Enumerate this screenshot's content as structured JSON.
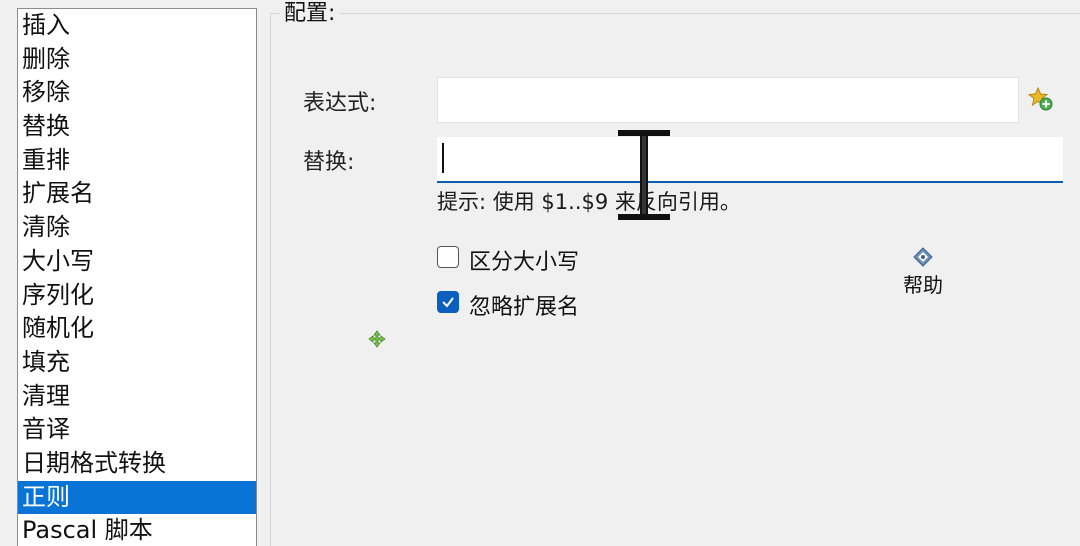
{
  "rules_list": {
    "items": [
      {
        "label": "插入",
        "selected": false
      },
      {
        "label": "删除",
        "selected": false
      },
      {
        "label": "移除",
        "selected": false
      },
      {
        "label": "替换",
        "selected": false
      },
      {
        "label": "重排",
        "selected": false
      },
      {
        "label": "扩展名",
        "selected": false
      },
      {
        "label": "清除",
        "selected": false
      },
      {
        "label": "大小写",
        "selected": false
      },
      {
        "label": "序列化",
        "selected": false
      },
      {
        "label": "随机化",
        "selected": false
      },
      {
        "label": "填充",
        "selected": false
      },
      {
        "label": "清理",
        "selected": false
      },
      {
        "label": "音译",
        "selected": false
      },
      {
        "label": "日期格式转换",
        "selected": false
      },
      {
        "label": "正则",
        "selected": true
      },
      {
        "label": "Pascal 脚本",
        "selected": false
      }
    ],
    "selected_color": "#0a74d6"
  },
  "config": {
    "group_title": "配置:",
    "expression_label": "表达式:",
    "expression_value": "",
    "replace_label": "替换:",
    "replace_value": "",
    "hint": "提示: 使用 $1..$9 来反向引用。",
    "case_sensitive_label": "区分大小写",
    "case_sensitive_checked": false,
    "ignore_extension_label": "忽略扩展名",
    "ignore_extension_checked": true,
    "help_label": "帮助"
  },
  "icons": {
    "add_expression": "star-add-icon",
    "help": "help-diamond-icon",
    "cursor": "text-ibeam-cursor-icon",
    "move": "move-cursor-icon"
  },
  "colors": {
    "accent": "#0a5fbf",
    "window_bg": "#f0f0f0"
  }
}
